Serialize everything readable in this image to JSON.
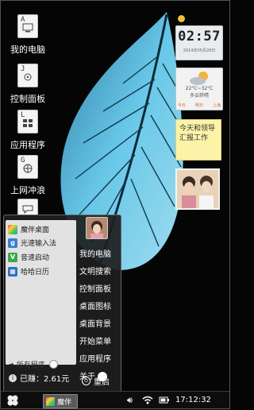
{
  "desktop": {
    "icons": [
      {
        "label": "我的电脑",
        "key": "A"
      },
      {
        "label": "控制面板",
        "key": "J"
      },
      {
        "label": "应用程序",
        "key": "L"
      },
      {
        "label": "上网冲浪",
        "key": "G"
      }
    ]
  },
  "widgets": {
    "clock": {
      "time": "02:57",
      "date": "2014年05月28日"
    },
    "weather": {
      "temp": "22°C~32°C",
      "desc": "多云转晴",
      "days": [
        "今日",
        "明日",
        "上海"
      ]
    },
    "note": {
      "text": "今天和领导汇报工作"
    }
  },
  "start_menu": {
    "apps": [
      "魔伴桌面",
      "光速输入法",
      "音速启动",
      "哈哈日历"
    ],
    "all_programs": "所有程序",
    "earnings": "已赚：2.61元",
    "right_items": [
      "我的电脑",
      "文明搜索",
      "控制面板",
      "桌面图标",
      "桌面背景",
      "开始菜单",
      "应用程序",
      "关于"
    ],
    "restart": "重启"
  },
  "taskbar": {
    "task_label": "魔伴",
    "time": "17:12:32"
  },
  "colors": {
    "leaf": "#66c6e6",
    "taskbar": "#0d0d0d",
    "note": "#fbf3a8"
  }
}
